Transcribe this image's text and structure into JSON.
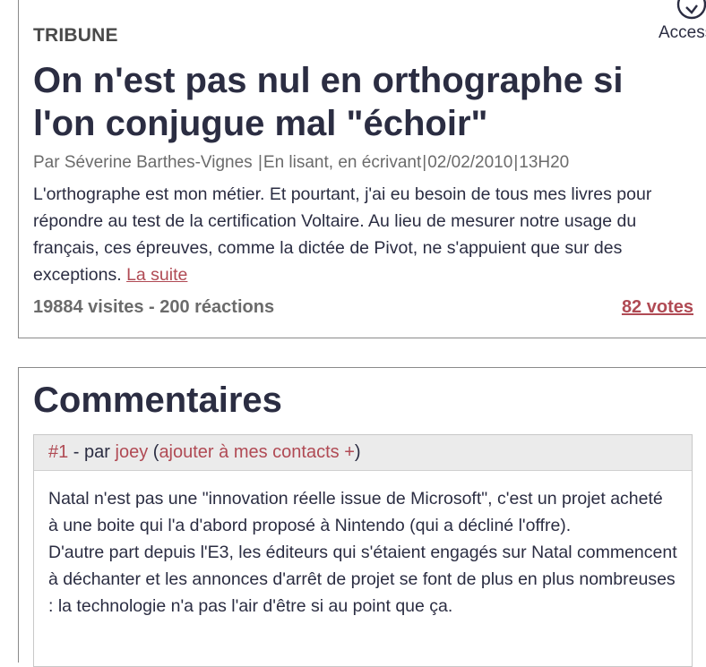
{
  "accessibility": {
    "label": "Accessibilité",
    "icon": "accessibility-icon"
  },
  "article": {
    "kicker": "TRIBUNE",
    "title": "On n'est pas nul en orthographe si l'on conjugue mal \"échoir\"",
    "byline": {
      "prefix": "Par",
      "author": "Séverine Barthes-Vignes",
      "category": "En lisant, en écrivant",
      "date": "02/02/2010",
      "time": "13H20"
    },
    "excerpt": "L'orthographe est mon métier. Et pourtant, j'ai eu besoin de tous mes livres pour répondre au test de la certification Voltaire. Au lieu de mesurer notre usage du français, ces épreuves, comme la dictée de Pivot, ne s'appuient que sur des exceptions.",
    "read_more": "La suite",
    "stats": "19884 visites - 200 réactions",
    "votes": "82 votes"
  },
  "comments": {
    "title": "Commentaires",
    "items": [
      {
        "number": "#1",
        "by": " - par ",
        "author": "joey",
        "add_contact": "ajouter à mes contacts +",
        "paragraphs": [
          "Natal n'est pas une \"innovation réelle issue de Microsoft\", c'est un projet acheté à une boite qui l'a d'abord proposé à Nintendo (qui a décliné l'offre).",
          "D'autre part depuis l'E3, les éditeurs qui s'étaient engagés sur Natal commencent à déchanter et les annonces d'arrêt de projet se font de plus en plus nombreuses : la technologie n'a pas l'air d'être si au point que ça."
        ]
      }
    ]
  },
  "colors": {
    "accent": "#b04a54",
    "text": "#2b2d42",
    "muted": "#6b6b6b"
  }
}
